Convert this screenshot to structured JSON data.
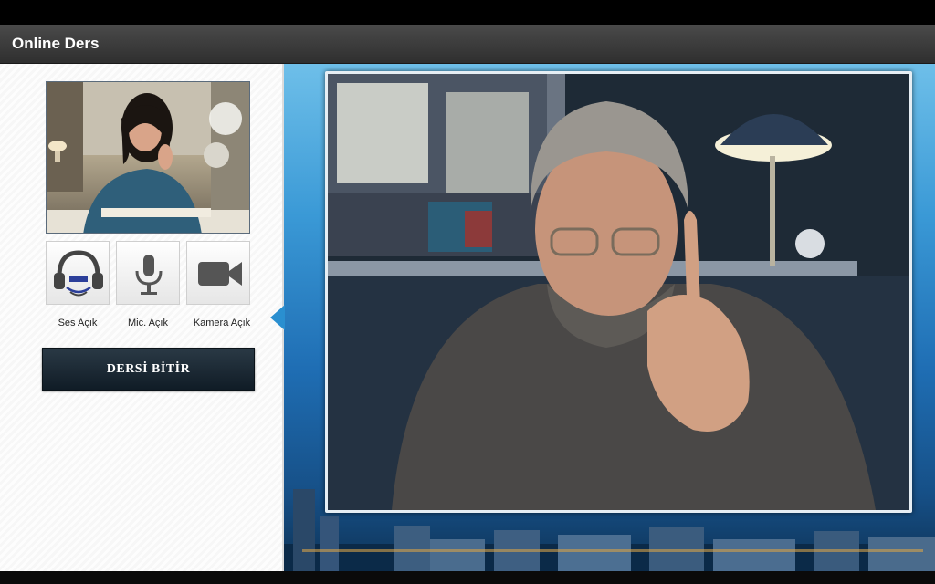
{
  "app": {
    "title": "Online Ders"
  },
  "self_video": {
    "name": "self-camera-preview"
  },
  "controls": [
    {
      "id": "sound",
      "icon": "headphones-icon",
      "label": "Ses Açık"
    },
    {
      "id": "mic",
      "icon": "microphone-icon",
      "label": "Mic. Açık"
    },
    {
      "id": "camera",
      "icon": "video-camera-icon",
      "label": "Kamera Açık"
    }
  ],
  "end_button": {
    "label": "DERSİ BİTİR"
  },
  "colors": {
    "accent": "#2a8fd0",
    "titlebar": "#3a3a3a",
    "button": "#1a2833"
  }
}
